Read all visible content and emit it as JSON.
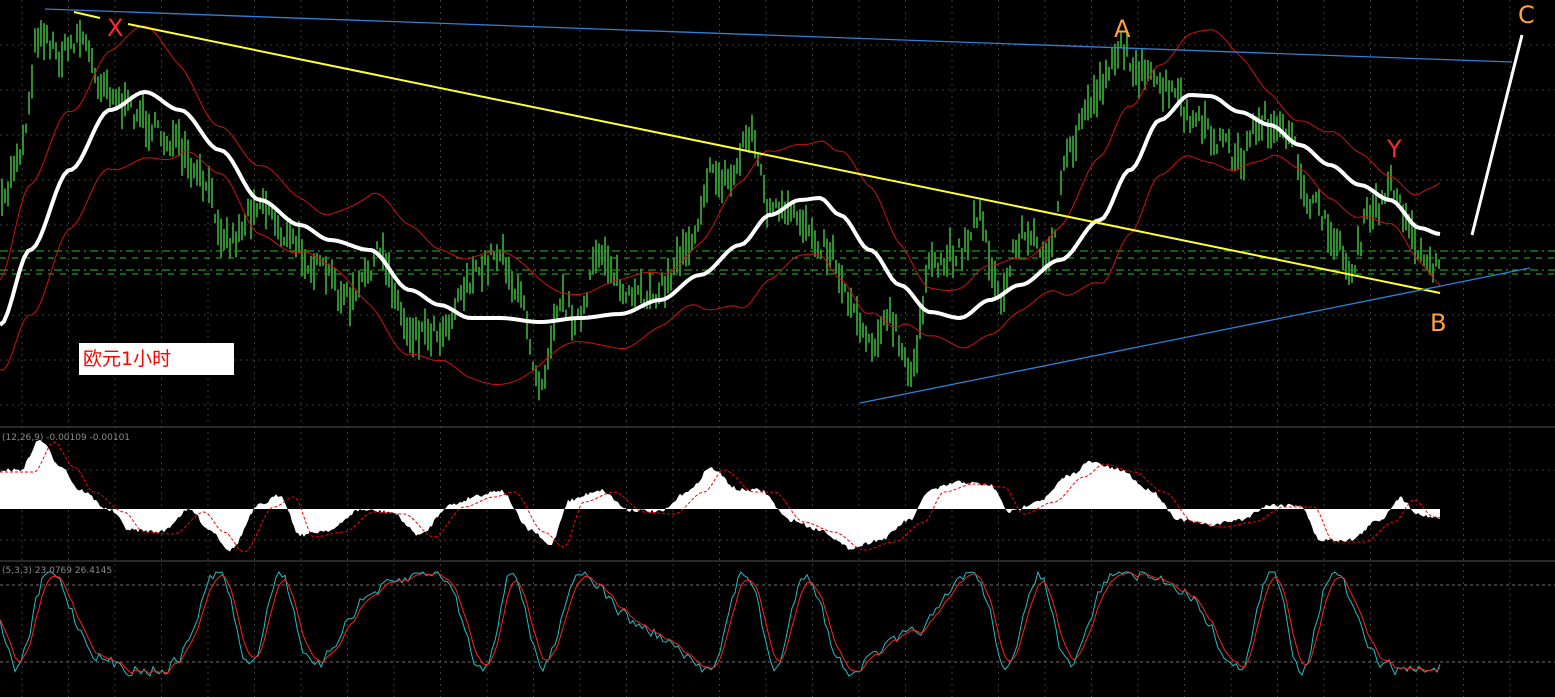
{
  "chart_data": [
    {
      "type": "line",
      "panel": "price",
      "symbol_label": "欧元1小时",
      "indicators": [
        "bollinger_bands",
        "moving_average"
      ],
      "annotations": [
        {
          "label": "X",
          "color": "#ff2a2a"
        },
        {
          "label": "A",
          "color": "#ffa040"
        },
        {
          "label": "Y",
          "color": "#ff2a2a"
        },
        {
          "label": "B",
          "color": "#ffa040"
        },
        {
          "label": "C",
          "color": "#ffa040"
        }
      ],
      "trendlines": [
        {
          "name": "upper-channel",
          "color": "#2f7fd6"
        },
        {
          "name": "x-b-line",
          "color": "#ffff33"
        },
        {
          "name": "lower-channel",
          "color": "#2f7fd6"
        },
        {
          "name": "projection-b-c",
          "color": "#ffffff"
        }
      ],
      "grid": true,
      "colors": {
        "candles": "#2f8f2f",
        "bands": "#d01010",
        "ma": "#ffffff",
        "levels": "#20c020"
      }
    },
    {
      "type": "area",
      "panel": "macd",
      "header": "(12,26,9) -0.00109 -0.00101",
      "colors": {
        "histogram": "#ffffff",
        "signal": "#ff0000"
      }
    },
    {
      "type": "line",
      "panel": "stochastic",
      "header": "(5,3,3) 23.0769 26.4145",
      "colors": {
        "main": "#20c0c0",
        "signal": "#ff2020"
      }
    }
  ]
}
